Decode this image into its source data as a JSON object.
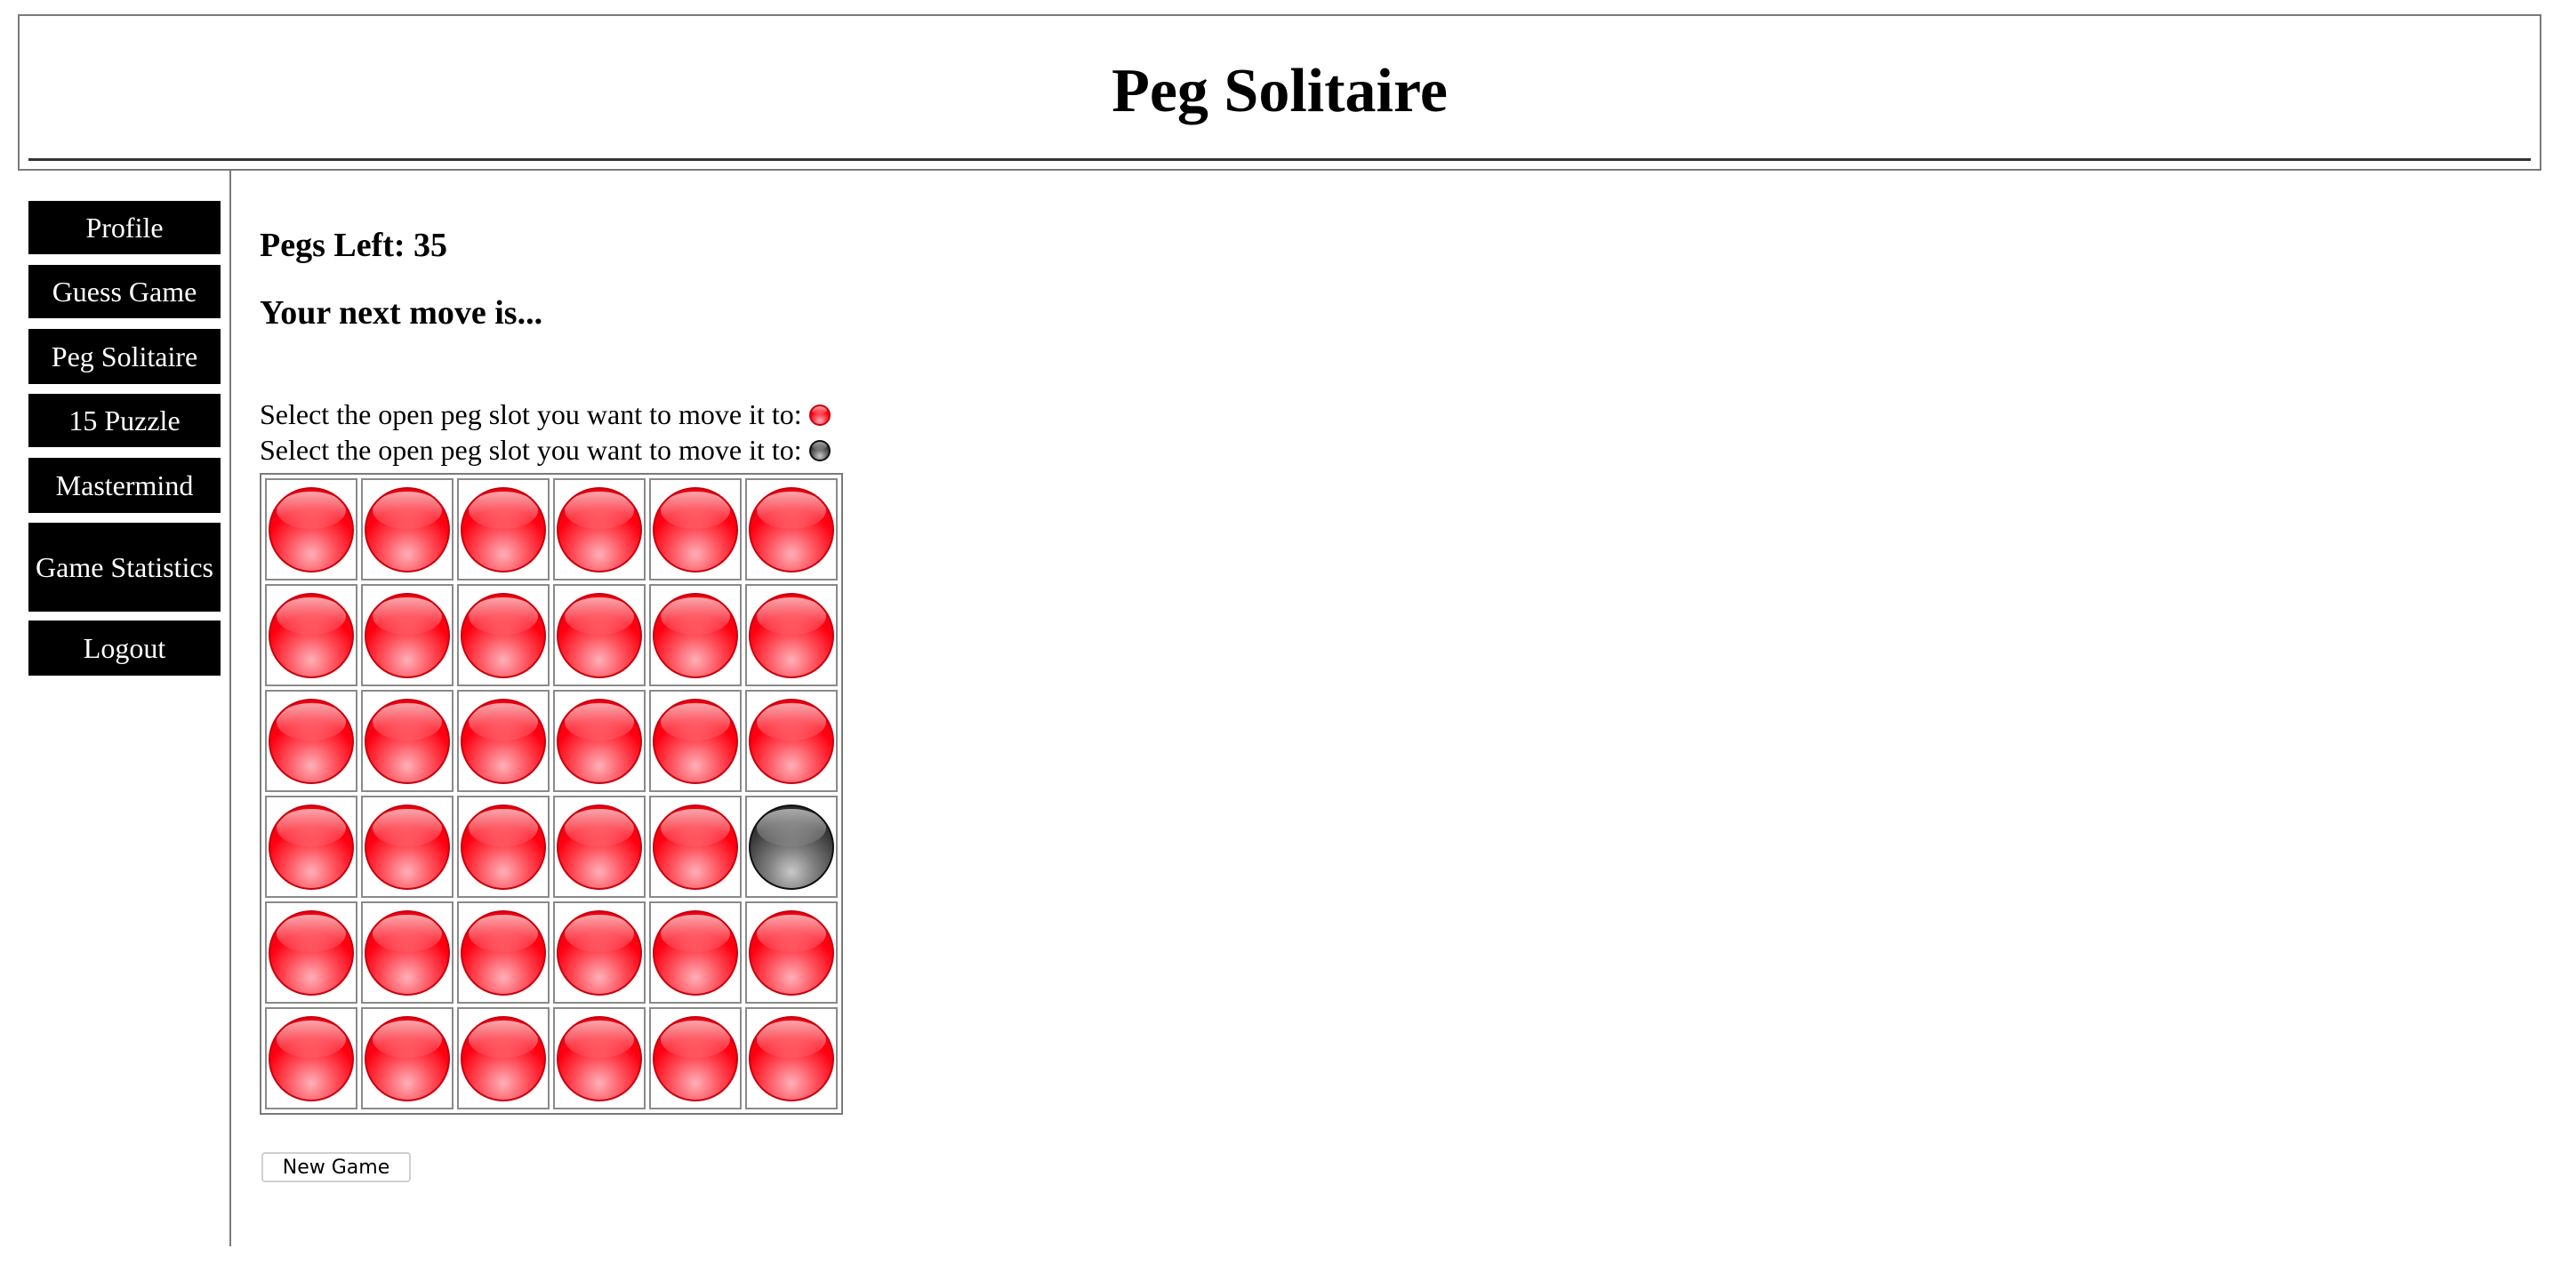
{
  "header": {
    "title": "Peg Solitaire"
  },
  "sidebar": {
    "items": [
      {
        "label": "Profile"
      },
      {
        "label": "Guess Game"
      },
      {
        "label": "Peg Solitaire"
      },
      {
        "label": "15 Puzzle"
      },
      {
        "label": "Mastermind"
      },
      {
        "label": "Game Statistics"
      },
      {
        "label": "Logout"
      }
    ]
  },
  "main": {
    "pegs_left": "Pegs Left: 35",
    "next_move": "Your next move is...",
    "instruction_1": "Select the open peg slot you want to move it to:",
    "instruction_2": "Select the open peg slot you want to move it to:",
    "new_game_label": "New Game"
  },
  "board": {
    "rows": 6,
    "cols": 6,
    "cells": [
      [
        "peg",
        "peg",
        "peg",
        "peg",
        "peg",
        "peg"
      ],
      [
        "peg",
        "peg",
        "peg",
        "peg",
        "peg",
        "peg"
      ],
      [
        "peg",
        "peg",
        "peg",
        "peg",
        "peg",
        "peg"
      ],
      [
        "peg",
        "peg",
        "peg",
        "peg",
        "peg",
        "empty"
      ],
      [
        "peg",
        "peg",
        "peg",
        "peg",
        "peg",
        "peg"
      ],
      [
        "peg",
        "peg",
        "peg",
        "peg",
        "peg",
        "peg"
      ]
    ],
    "peg_icon": "red-ball-icon",
    "empty_icon": "gray-ball-icon"
  },
  "colors": {
    "peg": "#ff0010",
    "empty_slot": "#3a3a3a",
    "nav_background": "#000000",
    "nav_text": "#ffffff"
  }
}
